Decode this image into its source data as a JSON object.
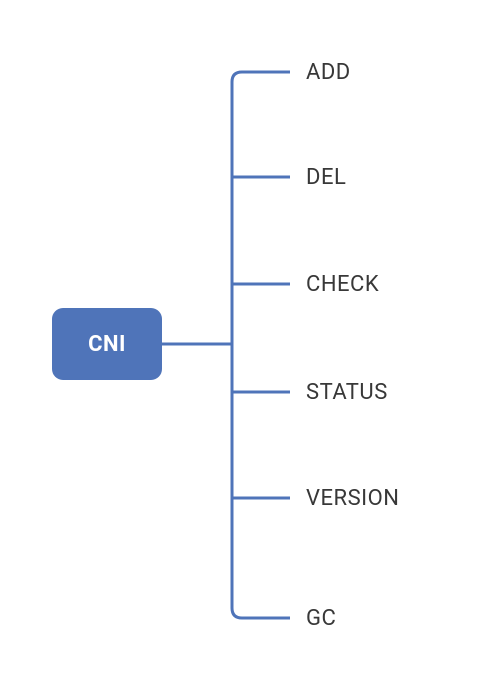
{
  "root": {
    "label": "CNI"
  },
  "leaves": [
    {
      "label": "ADD"
    },
    {
      "label": "DEL"
    },
    {
      "label": "CHECK"
    },
    {
      "label": "STATUS"
    },
    {
      "label": "VERSION"
    },
    {
      "label": "GC"
    }
  ],
  "colors": {
    "node_bg": "#4f74b9",
    "node_text": "#ffffff",
    "line": "#4f74b9",
    "leaf_text": "#383838"
  }
}
